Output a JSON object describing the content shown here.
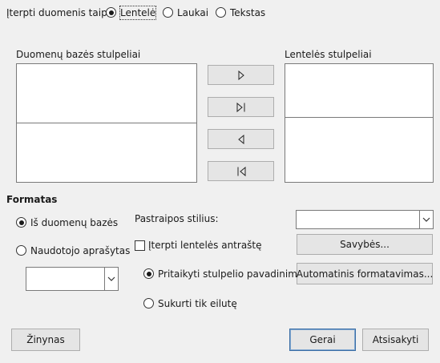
{
  "insert_as": {
    "label": "Įterpti duomenis taip:",
    "options": [
      "Lentelė",
      "Laukai",
      "Tekstas"
    ],
    "selected": "Lentelė"
  },
  "database_columns": {
    "label": "Duomenų bazės stulpeliai"
  },
  "table_columns": {
    "label": "Lentelės stulpeliai"
  },
  "move_buttons": {
    "move_one_right": "right-triangle-icon",
    "move_all_right": "right-triangle-bar-icon",
    "move_one_left": "left-triangle-icon",
    "move_all_left": "left-triangle-bar-icon"
  },
  "format": {
    "title": "Formatas",
    "from_database": "Iš duomenų bazės",
    "user_defined": "Naudotojo aprašytas",
    "selected": "from_database"
  },
  "paragraph_style": {
    "label": "Pastraipos stilius:",
    "value": ""
  },
  "insert_table_heading": {
    "label": "Įterpti lentelės antraštę",
    "checked": false
  },
  "apply_column_name": {
    "label": "Pritaikyti stulpelio pavadinimą",
    "checked": true
  },
  "create_row_only": {
    "label": "Sukurti tik eilutę",
    "checked": false
  },
  "buttons": {
    "properties": "Savybės...",
    "autoformat": "Automatinis formatavimas...",
    "help": "Žinynas",
    "ok": "Gerai",
    "cancel": "Atsisakyti"
  }
}
